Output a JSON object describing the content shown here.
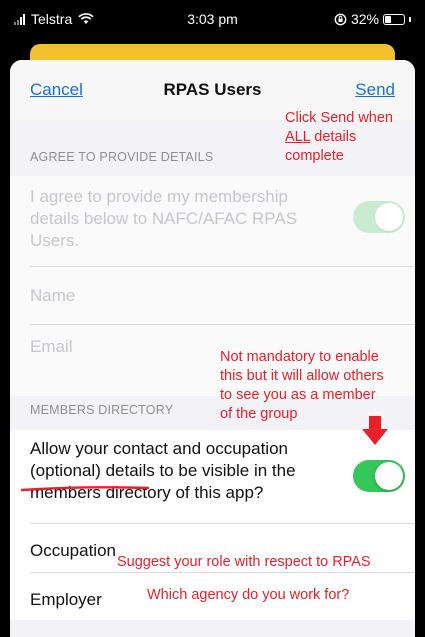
{
  "status_bar": {
    "carrier": "Telstra",
    "time": "3:03 pm",
    "battery": "32%"
  },
  "nav": {
    "cancel": "Cancel",
    "title": "RPAS Users",
    "send": "Send"
  },
  "agree_section": {
    "header": "AGREE TO PROVIDE DETAILS",
    "agree_text": "I agree to provide my membership details below to NAFC/AFAC RPAS Users.",
    "name_placeholder": "Name",
    "email_placeholder": "Email"
  },
  "directory_section": {
    "header": "MEMBERS DIRECTORY",
    "allow_text": "Allow your contact and occupation (optional) details to be visible in the members directory of this app?",
    "occupation_label": "Occupation",
    "employer_label": "Employer"
  },
  "annotations": {
    "send_note_line1": "Click Send when",
    "send_note_all": "ALL",
    "send_note_details": " details",
    "send_note_line3": "complete",
    "directory_note": [
      "Not mandatory to enable",
      "this but it will allow others",
      "to see you as a member",
      "of the group"
    ],
    "occupation_note": "Suggest your role with respect to RPAS",
    "employer_note": "Which agency do you work for?"
  },
  "toggles": {
    "agree_on": true,
    "directory_on": true
  },
  "colors": {
    "accent_blue": "#1a6fd6",
    "toggle_green": "#34c759",
    "annotation_red": "#e8202a",
    "sheet_bg": "#f2f2f7",
    "yellow": "#f2c12e"
  }
}
